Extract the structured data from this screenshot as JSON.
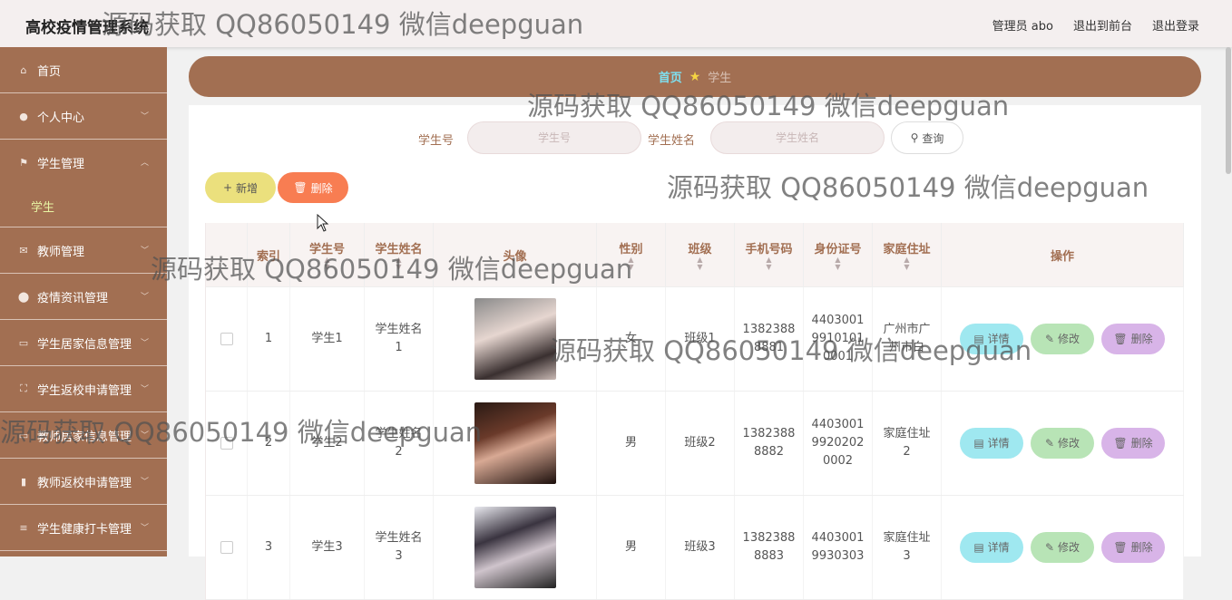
{
  "app": {
    "title": "高校疫情管理系统"
  },
  "header": {
    "admin_label": "管理员 abo",
    "front_label": "退出到前台",
    "logout_label": "退出登录"
  },
  "watermarks": [
    "源码获取 QQ86050149 微信deepguan",
    "源码获取 QQ86050149 微信deepguan",
    "源码获取 QQ86050149 微信deepguan",
    "源码获取 QQ86050149 微信deepguan",
    "源码获取 QQ86050149 微信deepguan",
    "源码获取 QQ86050149 微信deepguan"
  ],
  "sidebar": {
    "items": [
      {
        "label": "首页",
        "icon": "home-icon"
      },
      {
        "label": "个人中心",
        "icon": "user-icon"
      },
      {
        "label": "学生管理",
        "icon": "flag-icon"
      },
      {
        "label": "学生",
        "sub": true
      },
      {
        "label": "教师管理",
        "icon": "mail-icon"
      },
      {
        "label": "疫情资讯管理",
        "icon": "pin-icon"
      },
      {
        "label": "学生居家信息管理",
        "icon": "chat-icon"
      },
      {
        "label": "学生返校申请管理",
        "icon": "fullscreen-icon"
      },
      {
        "label": "教师居家信息管理",
        "icon": "chat-icon"
      },
      {
        "label": "教师返校申请管理",
        "icon": "chart-icon"
      },
      {
        "label": "学生健康打卡管理",
        "icon": "menu-icon"
      }
    ]
  },
  "breadcrumb": {
    "home": "首页",
    "current": "学生"
  },
  "search": {
    "student_no_label": "学生号",
    "student_no_placeholder": "学生号",
    "student_name_label": "学生姓名",
    "student_name_placeholder": "学生姓名",
    "query_label": "查询"
  },
  "actions": {
    "add_label": "新增",
    "delete_label": "删除"
  },
  "table": {
    "headers": [
      "索引",
      "学生号",
      "学生姓名",
      "头像",
      "性别",
      "班级",
      "手机号码",
      "身份证号",
      "家庭住址",
      "操作"
    ],
    "rows": [
      {
        "index": "1",
        "student_no": "学生1",
        "name": "学生姓名\n1",
        "gender": "女",
        "class": "班级1",
        "phone": "1382388\n8881",
        "id_card": "4403001\n9910101\n0001",
        "address": "广州市广\n州市白"
      },
      {
        "index": "2",
        "student_no": "学生2",
        "name": "学生姓名\n2",
        "gender": "男",
        "class": "班级2",
        "phone": "1382388\n8882",
        "id_card": "4403001\n9920202\n0002",
        "address": "家庭住址\n2"
      },
      {
        "index": "3",
        "student_no": "学生3",
        "name": "学生姓名\n3",
        "gender": "男",
        "class": "班级3",
        "phone": "1382388\n8883",
        "id_card": "4403001\n9930303",
        "address": "家庭住址\n3"
      }
    ],
    "op_labels": {
      "detail": "详情",
      "edit": "修改",
      "delete": "删除"
    }
  },
  "colors": {
    "brand": "#a26f52",
    "add_button": "#ebe07d",
    "delete_button": "#f87d52"
  }
}
